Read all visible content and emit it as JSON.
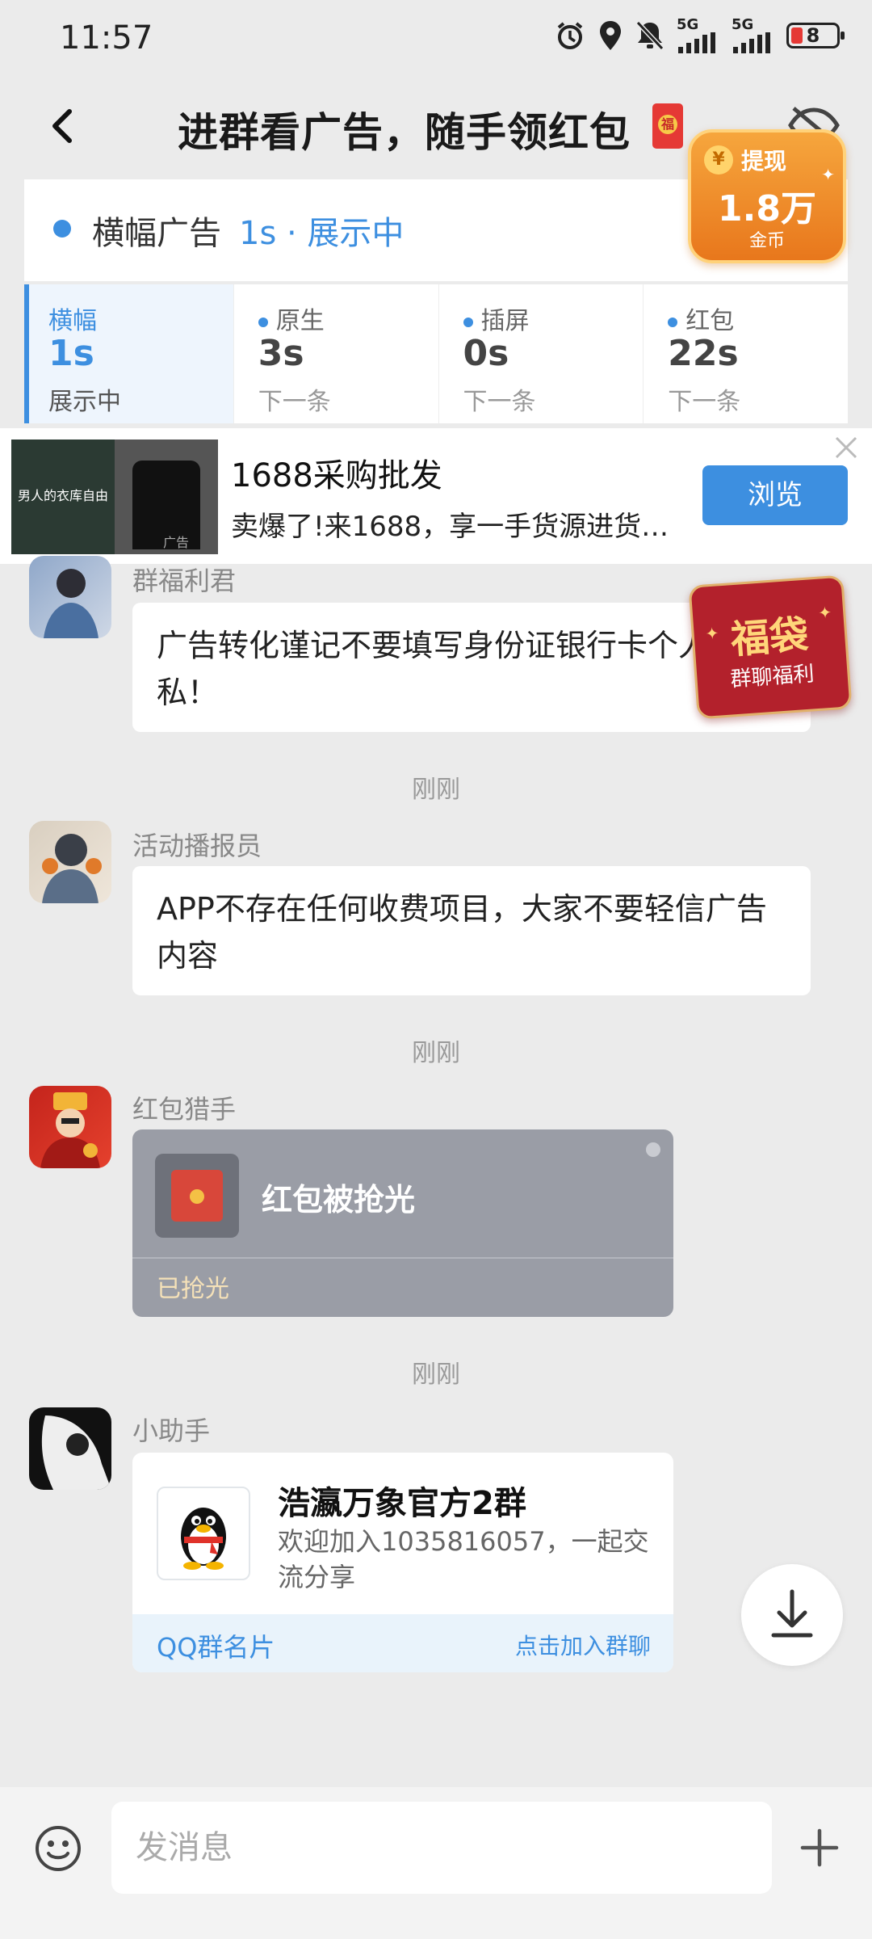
{
  "status_bar": {
    "time": "11:57",
    "signal1": "5G",
    "signal2": "5G",
    "battery": "8"
  },
  "header": {
    "title": "进群看广告，随手领红包",
    "redpacket_seal": "福"
  },
  "ad_panel": {
    "label": "横幅广告",
    "status": "1s · 展示中",
    "cells": [
      {
        "title": "横幅",
        "value": "1s",
        "sub": "展示中"
      },
      {
        "title": "原生",
        "value": "3s",
        "sub": "下一条"
      },
      {
        "title": "插屏",
        "value": "0s",
        "sub": "下一条"
      },
      {
        "title": "红包",
        "value": "22s",
        "sub": "下一条"
      }
    ]
  },
  "withdraw": {
    "coin_symbol": "¥",
    "label": "提现",
    "amount": "1.8万",
    "unit": "金币"
  },
  "banner_ad": {
    "image_text": "男人的衣库自由",
    "tag": "广告",
    "title": "1688采购批发",
    "desc": "卖爆了!来1688，享一手货源进货…",
    "button": "浏览"
  },
  "fudai": {
    "title": "福袋",
    "subtitle": "群聊福利"
  },
  "messages": [
    {
      "sender": "群福利君",
      "text": "广告转化谨记不要填写身份证银行卡个人隐私！"
    },
    {
      "timestamp": "刚刚",
      "sender": "活动播报员",
      "text": "APP不存在任何收费项目，大家不要轻信广告内容"
    },
    {
      "timestamp": "刚刚",
      "sender": "红包猎手",
      "card_title": "红包被抢光",
      "card_status": "已抢光"
    },
    {
      "timestamp": "刚刚",
      "sender": "小助手",
      "card_title": "浩瀛万象官方2群",
      "card_desc": "欢迎加入1035816057，一起交流分享",
      "card_footer_left": "QQ群名片",
      "card_footer_right": "点击加入群聊"
    }
  ],
  "input": {
    "placeholder": "发消息"
  },
  "colors": {
    "accent": "#3d8fe0",
    "withdraw": "#e8771c",
    "fudai": "#b3212c",
    "redpacket_card": "#9a9da6"
  }
}
